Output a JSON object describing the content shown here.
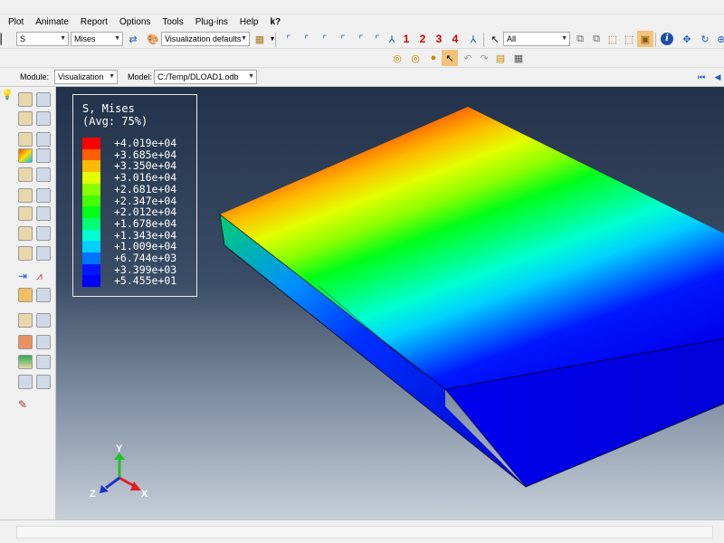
{
  "menu": [
    "Plot",
    "Animate",
    "Report",
    "Options",
    "Tools",
    "Plug-ins",
    "Help",
    "k?"
  ],
  "toolbar": {
    "step_value": "S",
    "invariant_value": "Mises",
    "viz_defaults": "Visualization defaults",
    "numbers": [
      "1",
      "2",
      "3",
      "4"
    ],
    "selection_filter": "All"
  },
  "module": {
    "module_label": "Module:",
    "module_value": "Visualization",
    "model_label": "Model:",
    "model_value": "C:/Temp/DLOAD1.odb"
  },
  "legend": {
    "title_line1": "S, Mises",
    "title_line2": "(Avg: 75%)",
    "entries": [
      {
        "value": "+4.019e+04",
        "color": "#ff0000"
      },
      {
        "value": "+3.685e+04",
        "color": "#ff5e00"
      },
      {
        "value": "+3.350e+04",
        "color": "#ffb900"
      },
      {
        "value": "+3.016e+04",
        "color": "#e3ff00"
      },
      {
        "value": "+2.681e+04",
        "color": "#8bff00"
      },
      {
        "value": "+2.347e+04",
        "color": "#46ff00"
      },
      {
        "value": "+2.012e+04",
        "color": "#00ff18"
      },
      {
        "value": "+1.678e+04",
        "color": "#00ff74"
      },
      {
        "value": "+1.343e+04",
        "color": "#00ffd0"
      },
      {
        "value": "+1.009e+04",
        "color": "#00d0ff"
      },
      {
        "value": "+6.744e+03",
        "color": "#0074ff"
      },
      {
        "value": "+3.399e+03",
        "color": "#0018ff"
      },
      {
        "value": "+5.455e+01",
        "color": "#0000ff"
      }
    ]
  },
  "triad": {
    "x": "X",
    "y": "Y",
    "z": "Z"
  },
  "colors": {
    "viewport_top": "#22324a",
    "viewport_bottom": "#c7cfd9",
    "accent_red": "#d40000"
  }
}
